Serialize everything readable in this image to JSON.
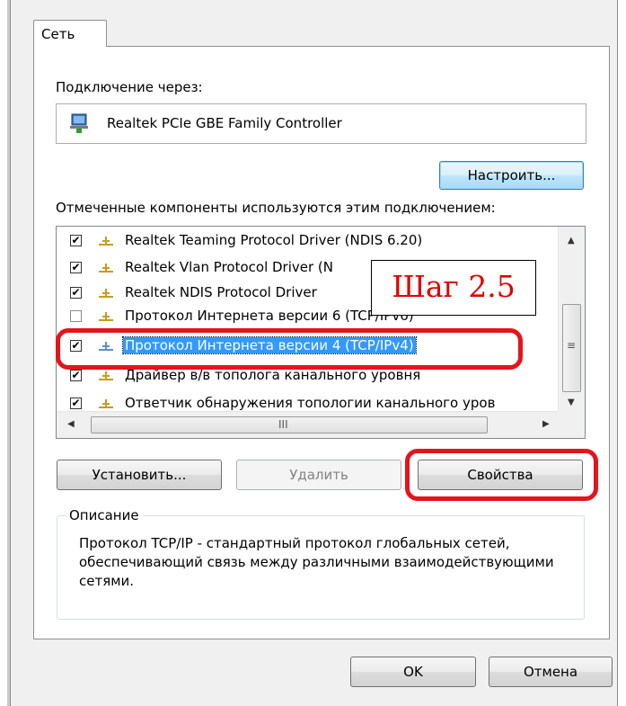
{
  "tab": {
    "label": "Сеть"
  },
  "connect_via": {
    "label": "Подключение через:",
    "adapter": "Realtek PCIe GBE Family Controller"
  },
  "buttons": {
    "configure": "Настроить...",
    "install": "Установить...",
    "uninstall": "Удалить",
    "properties": "Свойства",
    "ok": "OK",
    "cancel": "Отмена"
  },
  "components": {
    "label": "Отмеченные компоненты используются этим подключением:",
    "items": [
      {
        "label": "Realtek Teaming Protocol Driver (NDIS 6.20)",
        "checked": true,
        "selected": false
      },
      {
        "label": "Realtek Vlan Protocol Driver (N",
        "checked": true,
        "selected": false
      },
      {
        "label": "Realtek NDIS Protocol Driver",
        "checked": true,
        "selected": false
      },
      {
        "label": "Протокол Интернета версии 6 (TCP/IPv6)",
        "checked": false,
        "selected": false
      },
      {
        "label": "Протокол Интернета версии 4 (TCP/IPv4)",
        "checked": true,
        "selected": true
      },
      {
        "label": "Драйвер в/в тополога канального уровня",
        "checked": true,
        "selected": false
      },
      {
        "label": "Ответчик обнаружения топологии канального уров",
        "checked": true,
        "selected": false
      }
    ],
    "check_mark": "✔"
  },
  "description": {
    "title": "Описание",
    "text": "Протокол TCP/IP - стандартный протокол глобальных сетей, обеспечивающий связь между различными взаимодействующими сетями."
  },
  "annotation": {
    "label": "Шаг 2.5",
    "color": "#e5141c"
  },
  "scrollbar": {
    "grip": "≡",
    "hgrip": "III"
  }
}
